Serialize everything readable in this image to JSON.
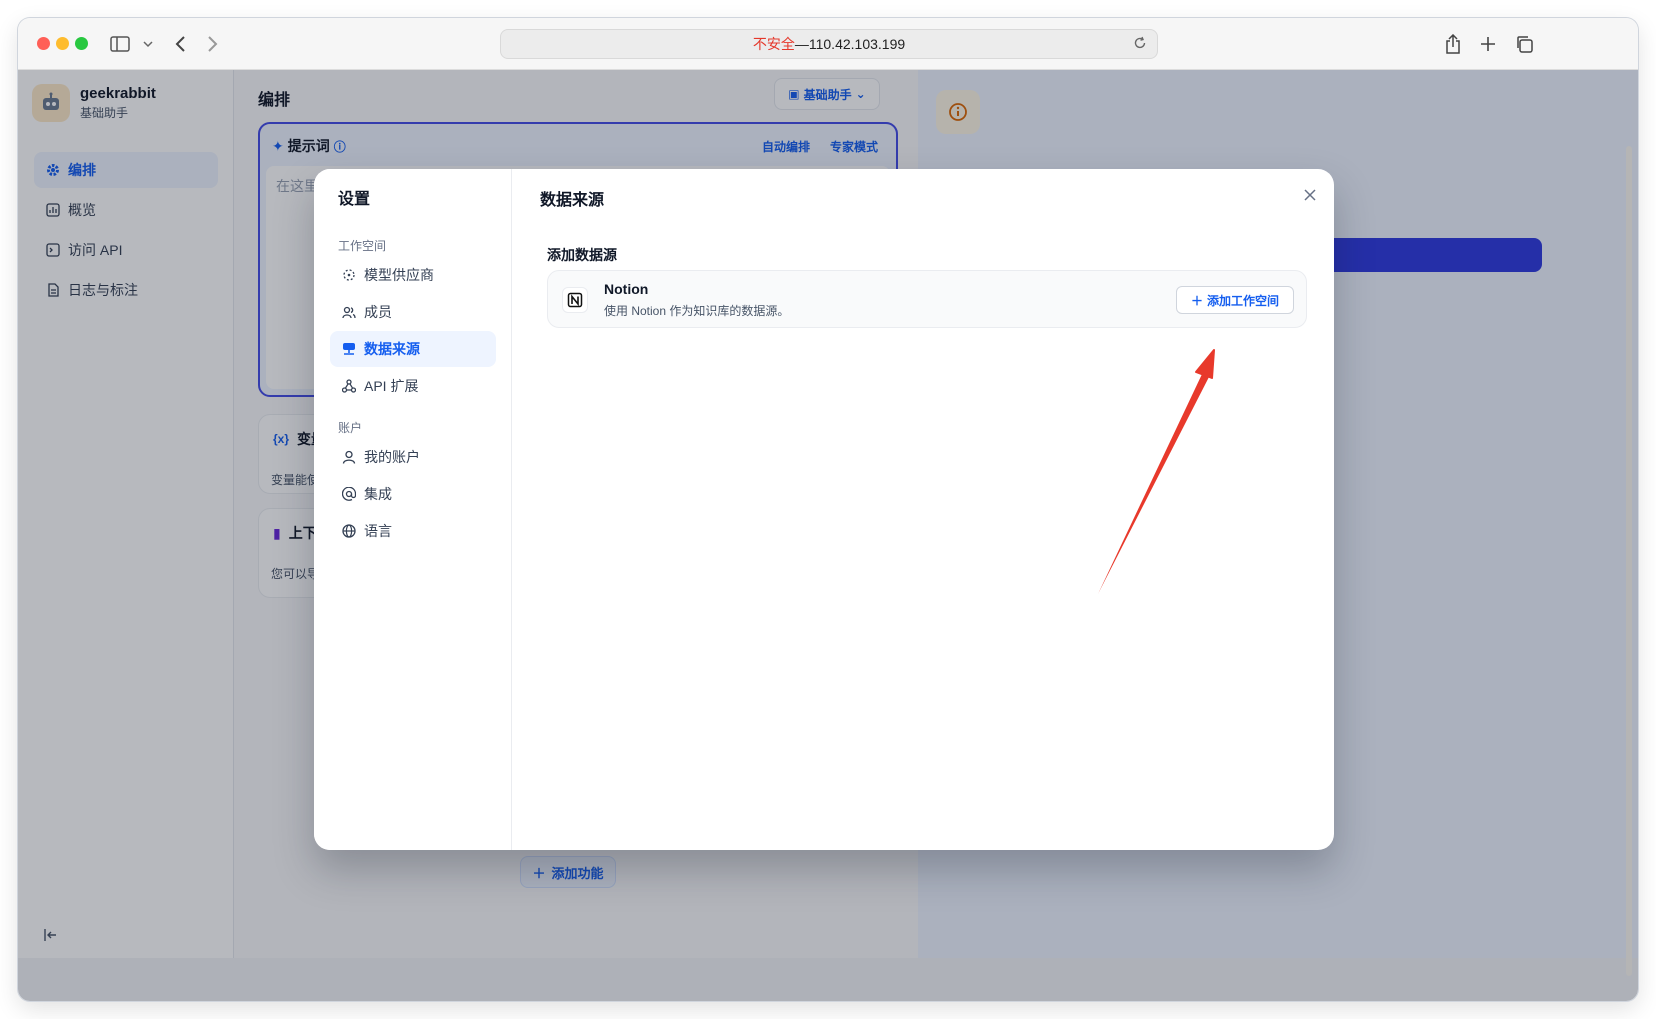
{
  "browser": {
    "url_warning": "不安全",
    "url_separator": " — ",
    "url_host": "110.42.103.199"
  },
  "app": {
    "name": "geekrabbit",
    "subtitle": "基础助手"
  },
  "sidebar": {
    "items": [
      {
        "label": "编排",
        "icon": "gear-icon",
        "active": true
      },
      {
        "label": "概览",
        "icon": "chart-icon",
        "active": false
      },
      {
        "label": "访问 API",
        "icon": "terminal-icon",
        "active": false
      },
      {
        "label": "日志与标注",
        "icon": "document-icon",
        "active": false
      }
    ]
  },
  "editor": {
    "title": "编排",
    "mode_button": "基础助手",
    "prompt": {
      "title": "提示词",
      "auto_label": "自动编排",
      "expert_label": "专家模式",
      "placeholder": "在这里"
    },
    "variables": {
      "title": "变量",
      "desc": "变量能使"
    },
    "context": {
      "title": "上下",
      "desc": "您可以导"
    },
    "add_feature": "添加功能"
  },
  "modal": {
    "title": "设置",
    "groups": [
      {
        "label": "工作空间",
        "items": [
          {
            "label": "模型供应商",
            "icon": "model-provider-icon",
            "active": false
          },
          {
            "label": "成员",
            "icon": "members-icon",
            "active": false
          },
          {
            "label": "数据来源",
            "icon": "database-icon",
            "active": true
          },
          {
            "label": "API 扩展",
            "icon": "webhook-icon",
            "active": false
          }
        ]
      },
      {
        "label": "账户",
        "items": [
          {
            "label": "我的账户",
            "icon": "user-icon",
            "active": false
          },
          {
            "label": "集成",
            "icon": "at-icon",
            "active": false
          },
          {
            "label": "语言",
            "icon": "globe-icon",
            "active": false
          }
        ]
      }
    ],
    "main_title": "数据来源",
    "section_title": "添加数据源",
    "datasource": {
      "name": "Notion",
      "desc": "使用 Notion 作为知识库的数据源。",
      "button": "添加工作空间"
    }
  },
  "colors": {
    "accent": "#155eef",
    "active_bg": "#eef4ff",
    "annotation_arrow": "#e8392b"
  }
}
